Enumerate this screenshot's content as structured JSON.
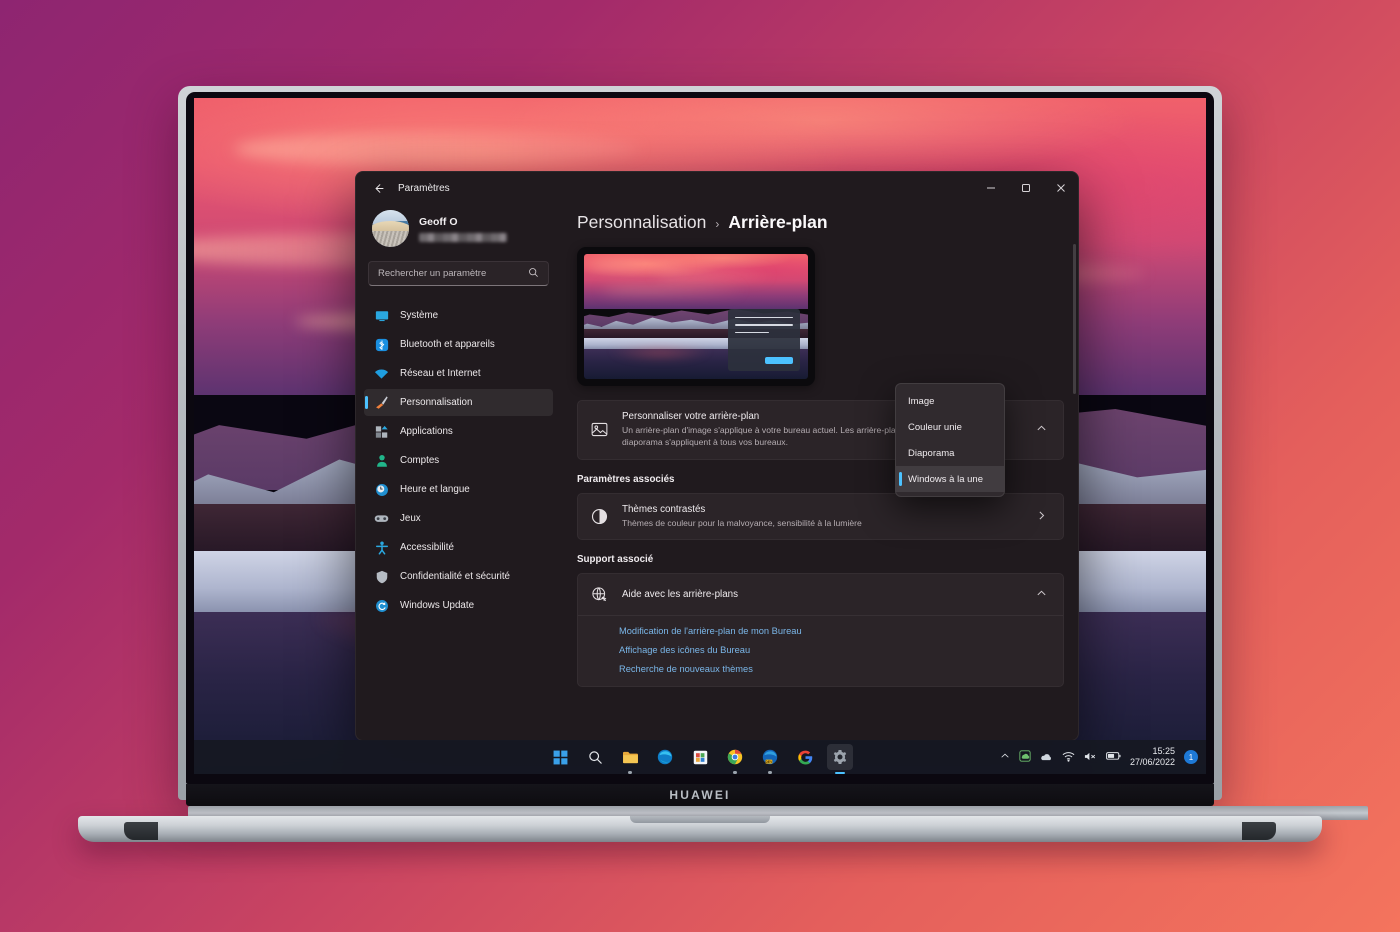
{
  "desktop": {
    "brand": "HUAWEI",
    "taskbar": {
      "icons": [
        {
          "name": "start-icon",
          "label": "Démarrer"
        },
        {
          "name": "search-icon",
          "label": "Rechercher"
        },
        {
          "name": "file-explorer-icon",
          "label": "Explorateur de fichiers"
        },
        {
          "name": "microsoft-edge-icon",
          "label": "Microsoft Edge"
        },
        {
          "name": "microsoft-store-icon",
          "label": "Microsoft Store"
        },
        {
          "name": "google-chrome-icon",
          "label": "Google Chrome"
        },
        {
          "name": "edge-dev-icon",
          "label": "Edge Dev"
        },
        {
          "name": "google-icon",
          "label": "Google"
        },
        {
          "name": "settings-icon",
          "label": "Paramètres"
        }
      ],
      "tray": {
        "show_hidden": "chevron-up-icon",
        "items": [
          "onedrive-icon",
          "cloud-icon",
          "wifi-icon",
          "volume-muted-icon",
          "battery-icon"
        ],
        "time": "15:25",
        "date": "27/06/2022",
        "notification_count": "1"
      }
    }
  },
  "window": {
    "title": "Paramètres",
    "back_label": "Précédent",
    "controls": {
      "minimize": "─",
      "maximize": "□",
      "close": "✕"
    }
  },
  "sidebar": {
    "profile": {
      "name": "Geoff O",
      "email_masked": true
    },
    "search": {
      "placeholder": "Rechercher un paramètre",
      "value": ""
    },
    "items": [
      {
        "label": "Système",
        "icon": "monitor-icon",
        "selected": false
      },
      {
        "label": "Bluetooth et appareils",
        "icon": "bluetooth-icon",
        "selected": false
      },
      {
        "label": "Réseau et Internet",
        "icon": "wifi-icon",
        "selected": false
      },
      {
        "label": "Personnalisation",
        "icon": "paintbrush-icon",
        "selected": true
      },
      {
        "label": "Applications",
        "icon": "apps-icon",
        "selected": false
      },
      {
        "label": "Comptes",
        "icon": "person-icon",
        "selected": false
      },
      {
        "label": "Heure et langue",
        "icon": "clock-icon",
        "selected": false
      },
      {
        "label": "Jeux",
        "icon": "gamepad-icon",
        "selected": false
      },
      {
        "label": "Accessibilité",
        "icon": "accessibility-icon",
        "selected": false
      },
      {
        "label": "Confidentialité et sécurité",
        "icon": "shield-icon",
        "selected": false
      },
      {
        "label": "Windows Update",
        "icon": "update-icon",
        "selected": false
      }
    ]
  },
  "content": {
    "breadcrumb": {
      "parent": "Personnalisation",
      "separator": "›",
      "current": "Arrière-plan"
    },
    "personalize": {
      "title": "Personnaliser votre arrière-plan",
      "description": "Un arrière-plan d'image s'applique à votre bureau actuel. Les arrière-plans de couleur unifier ou de diaporama s'appliquent à tous vos bureaux.",
      "icon": "image-icon",
      "expander": "chevron-up-icon"
    },
    "dropdown": {
      "selected": "Windows à la une",
      "options": [
        "Image",
        "Couleur unie",
        "Diaporama",
        "Windows à la une"
      ]
    },
    "related_settings": {
      "heading": "Paramètres associés",
      "items": [
        {
          "title": "Thèmes contrastés",
          "subtitle": "Thèmes de couleur pour la malvoyance, sensibilité à la lumière",
          "icon": "contrast-icon",
          "chevron": "chevron-right-icon"
        }
      ]
    },
    "support": {
      "heading": "Support associé",
      "title": "Aide avec les arrière-plans",
      "icon": "help-globe-icon",
      "expander": "chevron-up-icon",
      "links": [
        "Modification de l'arrière-plan de mon Bureau",
        "Affichage des icônes du Bureau",
        "Recherche de nouveaux thèmes"
      ]
    }
  },
  "colors": {
    "accent": "#4cc2ff",
    "link": "#7ab6e8",
    "window_bg": "#201a1e",
    "card_bg": "#2b2428",
    "bg_gradient_start": "#8e2571",
    "bg_gradient_end": "#f4745d"
  }
}
